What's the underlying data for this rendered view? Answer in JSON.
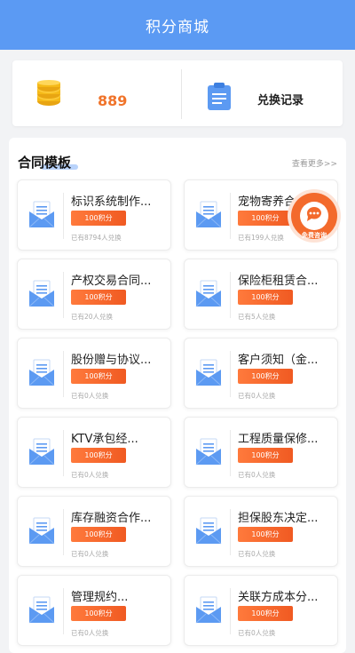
{
  "header": {
    "title": "积分商城"
  },
  "points": {
    "value": "889",
    "exchange_label": "兑换记录"
  },
  "section": {
    "title": "合同模板",
    "more": "查看更多>>"
  },
  "float_button": {
    "label": "免费咨询"
  },
  "items": [
    {
      "title": "标识系统制作...",
      "price": "100积分",
      "sub": "已有8794人兑换"
    },
    {
      "title": "宠物寄养合...",
      "price": "100积分",
      "sub": "已有199人兑换"
    },
    {
      "title": "产权交易合同...",
      "price": "100积分",
      "sub": "已有20人兑换"
    },
    {
      "title": "保险柜租赁合...",
      "price": "100积分",
      "sub": "已有5人兑换"
    },
    {
      "title": "股份赠与协议...",
      "price": "100积分",
      "sub": "已有0人兑换"
    },
    {
      "title": "客户须知（金...",
      "price": "100积分",
      "sub": "已有0人兑换"
    },
    {
      "title": "KTV承包经...",
      "price": "100积分",
      "sub": "已有0人兑换"
    },
    {
      "title": "工程质量保修...",
      "price": "100积分",
      "sub": "已有0人兑换"
    },
    {
      "title": "库存融资合作...",
      "price": "100积分",
      "sub": "已有0人兑换"
    },
    {
      "title": "担保股东决定...",
      "price": "100积分",
      "sub": "已有0人兑换"
    },
    {
      "title": "管理规约...",
      "price": "100积分",
      "sub": "已有0人兑换"
    },
    {
      "title": "关联方成本分...",
      "price": "100积分",
      "sub": "已有0人兑换"
    }
  ]
}
